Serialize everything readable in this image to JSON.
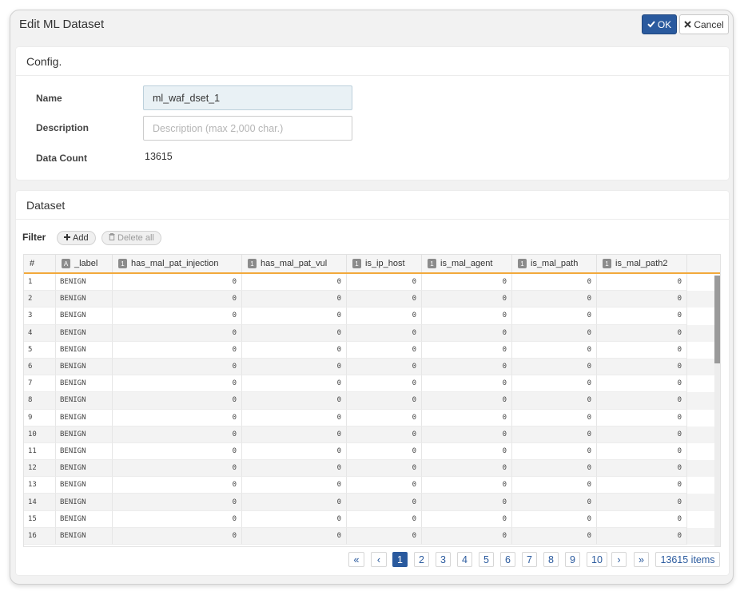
{
  "dialog": {
    "title": "Edit ML Dataset",
    "ok_label": "OK",
    "cancel_label": "Cancel"
  },
  "config": {
    "section_title": "Config.",
    "name_label": "Name",
    "name_value": "ml_waf_dset_1",
    "description_label": "Description",
    "description_value": "",
    "description_placeholder": "Description (max 2,000 char.)",
    "data_count_label": "Data Count",
    "data_count_value": "13615"
  },
  "dataset": {
    "section_title": "Dataset",
    "filter_label": "Filter",
    "add_label": "Add",
    "delete_all_label": "Delete all",
    "columns": [
      {
        "label": "#",
        "badge": ""
      },
      {
        "label": "_label",
        "badge": "A"
      },
      {
        "label": "has_mal_pat_injection",
        "badge": "1"
      },
      {
        "label": "has_mal_pat_vul",
        "badge": "1"
      },
      {
        "label": "is_ip_host",
        "badge": "1"
      },
      {
        "label": "is_mal_agent",
        "badge": "1"
      },
      {
        "label": "is_mal_path",
        "badge": "1"
      },
      {
        "label": "is_mal_path2",
        "badge": "1"
      }
    ],
    "rows": [
      [
        "1",
        "BENIGN",
        "0",
        "0",
        "0",
        "0",
        "0",
        "0"
      ],
      [
        "2",
        "BENIGN",
        "0",
        "0",
        "0",
        "0",
        "0",
        "0"
      ],
      [
        "3",
        "BENIGN",
        "0",
        "0",
        "0",
        "0",
        "0",
        "0"
      ],
      [
        "4",
        "BENIGN",
        "0",
        "0",
        "0",
        "0",
        "0",
        "0"
      ],
      [
        "5",
        "BENIGN",
        "0",
        "0",
        "0",
        "0",
        "0",
        "0"
      ],
      [
        "6",
        "BENIGN",
        "0",
        "0",
        "0",
        "0",
        "0",
        "0"
      ],
      [
        "7",
        "BENIGN",
        "0",
        "0",
        "0",
        "0",
        "0",
        "0"
      ],
      [
        "8",
        "BENIGN",
        "0",
        "0",
        "0",
        "0",
        "0",
        "0"
      ],
      [
        "9",
        "BENIGN",
        "0",
        "0",
        "0",
        "0",
        "0",
        "0"
      ],
      [
        "10",
        "BENIGN",
        "0",
        "0",
        "0",
        "0",
        "0",
        "0"
      ],
      [
        "11",
        "BENIGN",
        "0",
        "0",
        "0",
        "0",
        "0",
        "0"
      ],
      [
        "12",
        "BENIGN",
        "0",
        "0",
        "0",
        "0",
        "0",
        "0"
      ],
      [
        "13",
        "BENIGN",
        "0",
        "0",
        "0",
        "0",
        "0",
        "0"
      ],
      [
        "14",
        "BENIGN",
        "0",
        "0",
        "0",
        "0",
        "0",
        "0"
      ],
      [
        "15",
        "BENIGN",
        "0",
        "0",
        "0",
        "0",
        "0",
        "0"
      ],
      [
        "16",
        "BENIGN",
        "0",
        "0",
        "0",
        "0",
        "0",
        "0"
      ]
    ]
  },
  "pagination": {
    "first": "«",
    "prev": "‹",
    "pages": [
      "1",
      "2",
      "3",
      "4",
      "5",
      "6",
      "7",
      "8",
      "9",
      "10"
    ],
    "active_page": "1",
    "next": "›",
    "last": "»",
    "total_items": "13615 items"
  },
  "colors": {
    "primary": "#2a5a9e",
    "header_accent": "#f2a93b"
  }
}
